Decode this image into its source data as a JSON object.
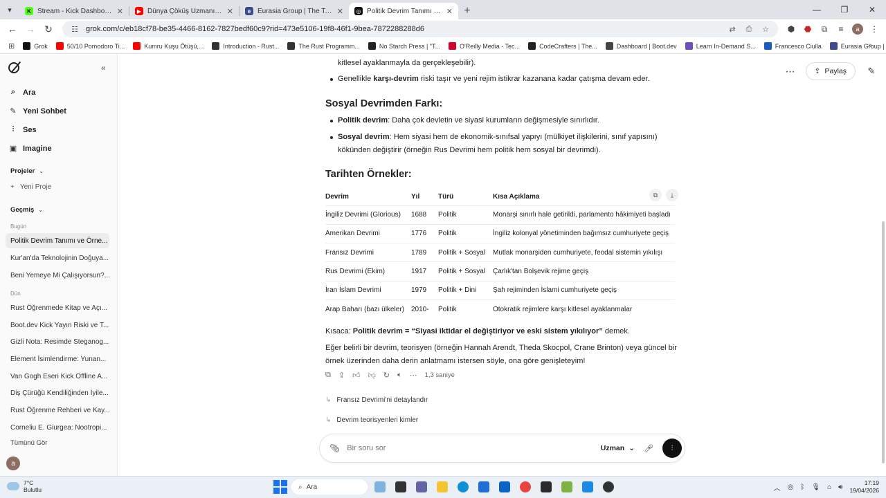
{
  "browser": {
    "tabs": [
      {
        "label": "Stream - Kick Dashboard",
        "color": "#53fc18",
        "active": false
      },
      {
        "label": "Dünya Çöküş Uzmanı Tarihin E",
        "color": "#ff0000",
        "active": false
      },
      {
        "label": "Eurasia Group | The Top Risks o",
        "color": "#3c4b8c",
        "active": false
      },
      {
        "label": "Politik Devrim Tanımı ve Örnekl",
        "color": "#111111",
        "active": true
      }
    ],
    "url": "grok.com/c/eb18cf78-be35-4466-8162-7827bedf60c9?rid=473e5106-19f8-46f1-9bea-7872288288d6",
    "bookmarks": [
      {
        "label": "Grok",
        "color": "#111111"
      },
      {
        "label": "50/10 Pomodoro Ti...",
        "color": "#ff0000"
      },
      {
        "label": "Kumru Kuşu Ötüşü,...",
        "color": "#ff0000"
      },
      {
        "label": "Introduction - Rust...",
        "color": "#333333"
      },
      {
        "label": "The Rust Programm...",
        "color": "#333333"
      },
      {
        "label": "No Starch Press | \"T...",
        "color": "#222222"
      },
      {
        "label": "O'Reilly Media - Tec...",
        "color": "#d3002d"
      },
      {
        "label": "CodeCrafters | The...",
        "color": "#222222"
      },
      {
        "label": "Dashboard | Boot.dev",
        "color": "#444444"
      },
      {
        "label": "Learn In-Demand S...",
        "color": "#6b4fbb"
      },
      {
        "label": "Francesco Ciulla",
        "color": "#1e5bbf"
      },
      {
        "label": "Eurasia Group | Home",
        "color": "#3c4b8c"
      }
    ]
  },
  "sidebar": {
    "main_items": [
      {
        "label": "Ara",
        "icon": "search-icon"
      },
      {
        "label": "Yeni Sohbet",
        "icon": "edit-icon"
      },
      {
        "label": "Ses",
        "icon": "voice-icon"
      },
      {
        "label": "Imagine",
        "icon": "image-icon"
      }
    ],
    "projects_title": "Projeler",
    "new_project": "Yeni Proje",
    "history_title": "Geçmiş",
    "today_label": "Bugün",
    "yesterday_label": "Dün",
    "today_items": [
      "Politik Devrim Tanımı ve Örne...",
      "Kur'an'da Teknolojinin Doğuya...",
      "Beni Yemeye Mi Çalışıyorsun?..."
    ],
    "yesterday_items": [
      "Rust Öğrenmede Kitap ve Açı...",
      "Boot.dev Kick Yayın Riski ve T...",
      "Gizli Nota: Resimde Steganog...",
      "Element İsimlendirme: Yunan...",
      "Van Gogh Eseri Kick Offline A...",
      "Diş Çürüğü Kendiliğinden İyile...",
      "Rust Öğrenme Rehberi ve Kay...",
      "Corneliu E. Giurgea: Nootropi..."
    ],
    "see_all": "Tümünü Gör",
    "avatar": "a"
  },
  "header": {
    "share_label": "Paylaş"
  },
  "answer": {
    "line_top": "kitlesel ayaklanmayla da gerçekleşebilir).",
    "bullet_counter_pre": "Genellikle ",
    "bullet_counter_bold": "karşı-devrim",
    "bullet_counter_post": " riski taşır ve yeni rejim istikrar kazanana kadar çatışma devam eder.",
    "section1_title": "Sosyal Devrimden Farkı:",
    "political_bold": "Politik devrim",
    "political_text": ": Daha çok devletin ve siyasi kurumların değişmesiyle sınırlıdır.",
    "social_bold": "Sosyal devrim",
    "social_text": ": Hem siyasi hem de ekonomik-sınıfsal yapıyı (mülkiyet ilişkilerini, sınıf yapısını) kökünden değiştirir (örneğin Rus Devrimi hem politik hem sosyal bir devrimdi).",
    "section2_title": "Tarihten Örnekler:",
    "table": {
      "headers": [
        "Devrim",
        "Yıl",
        "Türü",
        "Kısa Açıklama"
      ],
      "rows": [
        [
          "İngiliz Devrimi (Glorious)",
          "1688",
          "Politik",
          "Monarşi sınırlı hale getirildi, parlamento hâkimiyeti başladı"
        ],
        [
          "Amerikan Devrimi",
          "1776",
          "Politik",
          "İngiliz kolonyal yönetiminden bağımsız cumhuriyete geçiş"
        ],
        [
          "Fransız Devrimi",
          "1789",
          "Politik + Sosyal",
          "Mutlak monarşiden cumhuriyete, feodal sistemin yıkılışı"
        ],
        [
          "Rus Devrimi (Ekim)",
          "1917",
          "Politik + Sosyal",
          "Çarlık'tan Bolşevik rejime geçiş"
        ],
        [
          "İran İslam Devrimi",
          "1979",
          "Politik + Dini",
          "Şah rejiminden İslami cumhuriyete geçiş"
        ],
        [
          "Arap Baharı (bazı ülkeler)",
          "2010-",
          "Politik",
          "Otokratik rejimlere karşı kitlesel ayaklanmalar"
        ]
      ]
    },
    "summary_pre": "Kısaca: ",
    "summary_bold": "Politik devrim = “Siyasi iktidar el değiştiriyor ve eski sistem yıkılıyor”",
    "summary_post": " demek.",
    "closing": "Eğer belirli bir devrim, teorisyen (örneğin Hannah Arendt, Theda Skocpol, Crane Brinton) veya güncel bir örnek üzerinden daha derin anlatmamı istersen söyle, ona göre genişleteyim!",
    "response_time": "1,3 saniye"
  },
  "followups": [
    "Fransız Devrimi'ni detaylandır",
    "Devrim teorisyenleri kimler"
  ],
  "composer": {
    "placeholder": "Bir soru sor",
    "model": "Uzman"
  },
  "taskbar": {
    "temp": "7°C",
    "weather": "Bulutlu",
    "search": "Ara",
    "time": "17:19",
    "date": "19/04/2026"
  }
}
